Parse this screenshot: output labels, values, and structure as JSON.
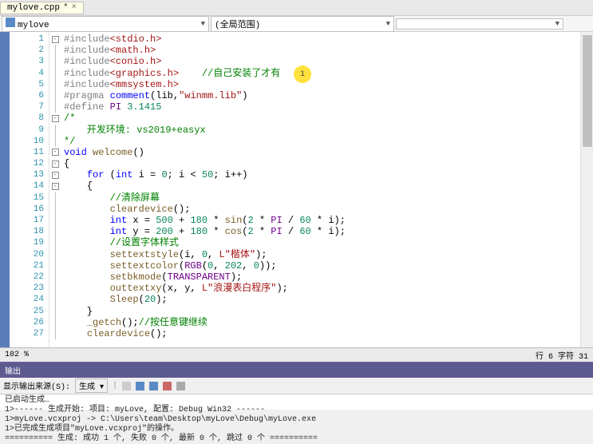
{
  "tab": {
    "filename": "mylove.cpp",
    "dirty_marker": "*"
  },
  "context": {
    "scope_icon": "cpp",
    "scope_label": "mylove",
    "member_label": "(全局范围)"
  },
  "annotation_marker": "1",
  "code_lines": [
    {
      "n": 1,
      "html": "<span class='pp'>#include</span><span class='inc'>&lt;stdio.h&gt;</span>"
    },
    {
      "n": 2,
      "html": "<span class='pp'>#include</span><span class='inc'>&lt;math.h&gt;</span>"
    },
    {
      "n": 3,
      "html": "<span class='pp'>#include</span><span class='inc'>&lt;conio.h&gt;</span>"
    },
    {
      "n": 4,
      "html": "<span class='pp'>#include</span><span class='inc'>&lt;graphics.h&gt;</span>    <span class='cmt'>//自己安装了才有</span>"
    },
    {
      "n": 5,
      "html": "<span class='pp'>#include</span><span class='inc'>&lt;mmsystem.h&gt;</span>"
    },
    {
      "n": 6,
      "html": "<span class='pp'>#pragma</span> <span class='kw'>comment</span>(lib,<span class='str'>\"winmm.lib\"</span>)"
    },
    {
      "n": 7,
      "html": "<span class='pp'>#define</span> <span class='macro'>PI</span> <span class='num'>3.1415</span>"
    },
    {
      "n": 8,
      "html": "<span class='cmt'>/*</span>"
    },
    {
      "n": 9,
      "html": "<span class='cmt'>    开发环境: vs2019+easyx</span>"
    },
    {
      "n": 10,
      "html": "<span class='cmt'>*/</span>"
    },
    {
      "n": 11,
      "html": "<span class='kw'>void</span> <span class='fn'>welcome</span>()"
    },
    {
      "n": 12,
      "html": "{"
    },
    {
      "n": 13,
      "html": "    <span class='kw'>for</span> (<span class='kw'>int</span> i = <span class='num'>0</span>; i &lt; <span class='num'>50</span>; i++)"
    },
    {
      "n": 14,
      "html": "    {"
    },
    {
      "n": 15,
      "html": "        <span class='cmt'>//清除屏幕</span>"
    },
    {
      "n": 16,
      "html": "        <span class='fn'>cleardevice</span>();"
    },
    {
      "n": 17,
      "html": "        <span class='kw'>int</span> x = <span class='num'>500</span> + <span class='num'>180</span> * <span class='fn'>sin</span>(<span class='num'>2</span> * <span class='macro'>PI</span> / <span class='num'>60</span> * i);"
    },
    {
      "n": 18,
      "html": "        <span class='kw'>int</span> y = <span class='num'>200</span> + <span class='num'>180</span> * <span class='fn'>cos</span>(<span class='num'>2</span> * <span class='macro'>PI</span> / <span class='num'>60</span> * i);"
    },
    {
      "n": 19,
      "html": "        <span class='cmt'>//设置字体样式</span>"
    },
    {
      "n": 20,
      "html": "        <span class='fn'>settextstyle</span>(i, <span class='num'>0</span>, <span class='str'>L\"楷体\"</span>);"
    },
    {
      "n": 21,
      "html": "        <span class='fn'>settextcolor</span>(<span class='macro'>RGB</span>(<span class='num'>0</span>, <span class='num'>202</span>, <span class='num'>0</span>));"
    },
    {
      "n": 22,
      "html": "        <span class='fn'>setbkmode</span>(<span class='macro'>TRANSPARENT</span>);"
    },
    {
      "n": 23,
      "html": "        <span class='fn'>outtextxy</span>(x, y, <span class='str'>L\"浪漫表白程序\"</span>);"
    },
    {
      "n": 24,
      "html": "        <span class='fn'>Sleep</span>(<span class='num'>20</span>);"
    },
    {
      "n": 25,
      "html": "    }"
    },
    {
      "n": 26,
      "html": "    <span class='fn'>_getch</span>();<span class='cmt'>//按任意键继续</span>"
    },
    {
      "n": 27,
      "html": "    <span class='fn'>cleardevice</span>();"
    }
  ],
  "outline": {
    "1": "minus",
    "8": "minus",
    "11": "minus",
    "12": "minus",
    "13": "minus",
    "14": "minus"
  },
  "status": {
    "zoom": "102 %",
    "right": "行 6   字符 31"
  },
  "output": {
    "panel_title": "输出",
    "source_label": "显示输出来源(S):",
    "source_value": "生成",
    "lines": [
      "已启动生成…",
      "1>------ 生成开始: 项目: myLove, 配置: Debug Win32 ------",
      "1>myLove.vcxproj -> C:\\Users\\team\\Desktop\\myLove\\Debug\\myLove.exe",
      "1>已完成生成项目\"myLove.vcxproj\"的操作。",
      "========== 生成: 成功 1 个, 失败 0 个, 最新 0 个, 跳过 0 个 =========="
    ]
  }
}
